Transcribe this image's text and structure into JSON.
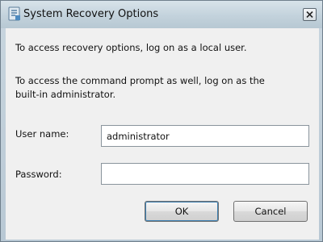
{
  "window": {
    "title": "System Recovery Options",
    "icon": "recovery-app-icon",
    "close_icon": "close-icon"
  },
  "messages": {
    "local_user": "To access recovery options, log on as a local user.",
    "admin": "To access the command prompt as well, log on as the built-in administrator."
  },
  "form": {
    "username_label": "User name:",
    "username_value": "administrator",
    "password_label": "Password:",
    "password_value": ""
  },
  "buttons": {
    "ok": "OK",
    "cancel": "Cancel"
  }
}
